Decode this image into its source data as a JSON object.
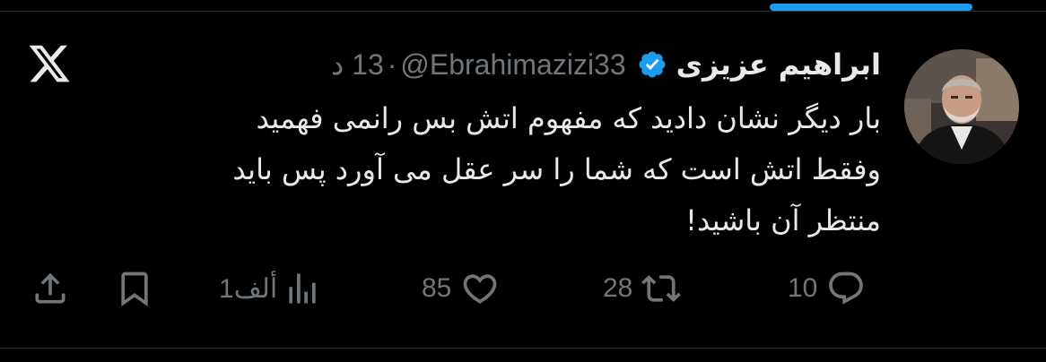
{
  "tweet": {
    "display_name": "ابراهیم عزیزی",
    "handle": "@Ebrahimazizi33",
    "separator": "·",
    "time": "13 د",
    "text_lines": [
      "بار دیگر نشان دادید که مفهوم اتش بس رانمی فهمید",
      "وفقط اتش است که شما را سر عقل می آورد پس باید",
      "منتظر آن باشید!"
    ]
  },
  "actions": {
    "replies": "10",
    "reposts": "28",
    "likes": "85",
    "views": "1ألف"
  },
  "icons": {
    "brand": "x-logo-icon",
    "verified": "verified-badge-icon",
    "reply": "reply-icon",
    "repost": "repost-icon",
    "like": "heart-icon",
    "views": "views-chart-icon",
    "bookmark": "bookmark-icon",
    "share": "share-icon"
  },
  "colors": {
    "background": "#000000",
    "text_primary": "#e7e9ea",
    "text_secondary": "#71767b",
    "accent": "#1d9bf0",
    "divider": "#2f3336"
  }
}
